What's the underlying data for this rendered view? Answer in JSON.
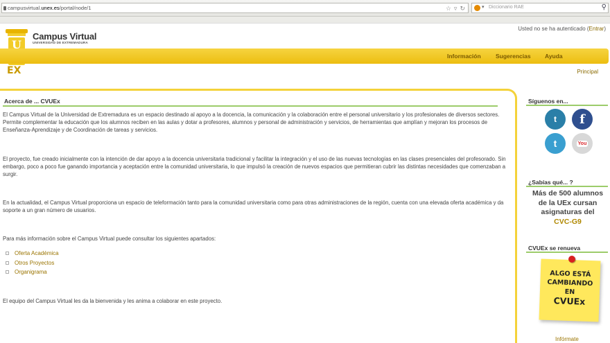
{
  "browser": {
    "url_prefix": "campusvirtual.",
    "url_domain": "unex.es",
    "url_path": "/portal/node/1",
    "search_placeholder": "Diccionario RAE"
  },
  "header": {
    "auth_text": "Usted no se ha autenticado (",
    "auth_link": "Entrar",
    "auth_close": ")",
    "logo_pillar_text": "U",
    "logo_ex": "EX",
    "logo_title": "Campus Virtual",
    "logo_subtitle": "UNIVERSIDAD DE EXTREMADURA",
    "nav": [
      "Información",
      "Sugerencias",
      "Ayuda"
    ],
    "breadcrumb": "Principal"
  },
  "main": {
    "title": "Acerca de ... CVUEx",
    "paragraphs": [
      "El Campus Virtual de la Universidad de Extremadura es un espacio destinado al apoyo a la docencia, la comunicación y la colaboración entre el personal universitario y los profesionales de diversos sectores. Permite complementar la educación que los alumnos reciben en las aulas y dotar a profesores, alumnos y personal de administración y servicios, de herramientas que amplían y mejoran los procesos de Enseñanza-Aprendizaje y de Coordinación de tareas y servicios.",
      "El proyecto, fue creado inicialmente con la intención de dar apoyo a la docencia universitaria tradicional y facilitar la integración y el uso de las nuevas tecnologías en las clases presenciales del profesorado. Sin embargo, poco a poco fue ganando importancia y aceptación entre la comunidad universitaria, lo que impulsó la creación de nuevos espacios que permitieran cubrir las distintas necesidades que comenzaban a surgir.",
      "En la actualidad, el Campus Virtual proporciona un espacio de teleformación tanto para la comunidad universitaria como para otras administraciones de la región, cuenta con una elevada oferta académica y da soporte a un gran número de usuarios.",
      "Para más información sobre el Campus Virtual puede consultar los siguientes apartados:"
    ],
    "links": [
      "Oferta Académica",
      "Otros Proyectos",
      "Organigrama"
    ],
    "closing": "El equipo del Campus Virtual les da la bienvenida y les anima a colaborar en este proyecto."
  },
  "sidebar": {
    "follow_title": "Síguenos en...",
    "social_icons": [
      "tuenti-icon",
      "facebook-icon",
      "twitter-icon",
      "youtube-icon"
    ],
    "tuenti_glyph": "t",
    "facebook_glyph": "f",
    "twitter_glyph": "t",
    "youtube_glyph": "You",
    "sabias_title": "¿Sabías qué... ?",
    "sabias_line1": "Más de 500 alumnos",
    "sabias_line2": "de la UEx cursan",
    "sabias_line3": "asignaturas del",
    "sabias_highlight": "CVC-G9",
    "renueva_title": "CVUEx se renueva",
    "postit_line1": "ALGO ESTÁ",
    "postit_line2": "CAMBIANDO",
    "postit_line3": "EN",
    "postit_line4": "CVUEx",
    "informate": "Infórmate"
  },
  "colors": {
    "accent_yellow": "#f4d23a",
    "rule_green": "#9ccc6a",
    "link_gold": "#9a7400"
  }
}
